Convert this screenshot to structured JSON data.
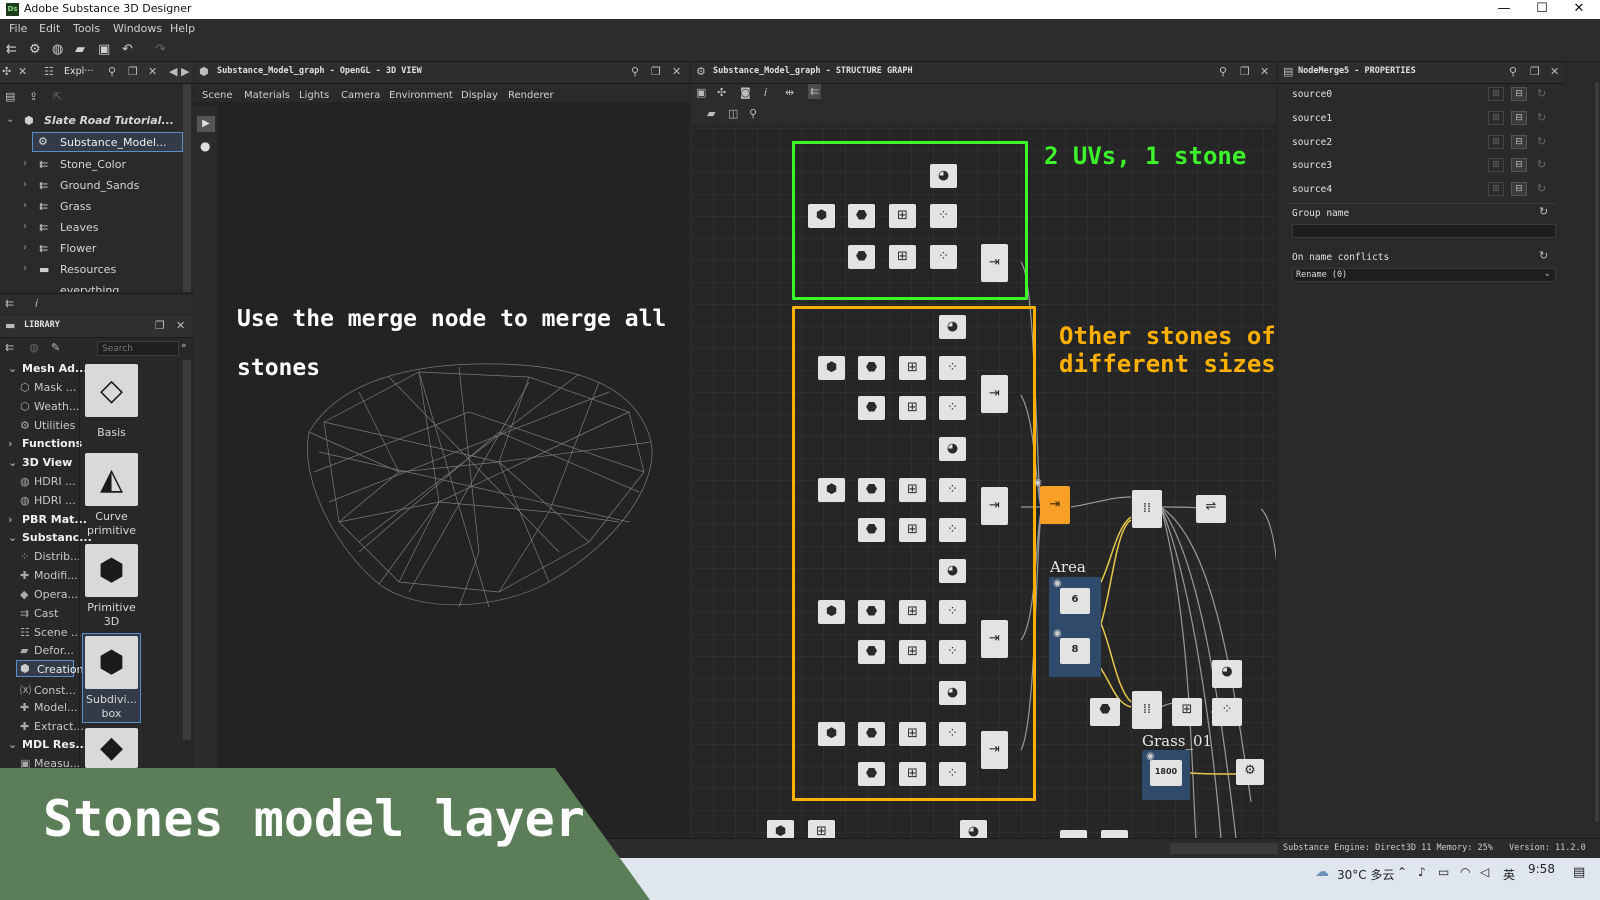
{
  "window": {
    "title": "Adobe Substance 3D Designer",
    "logo": "Ds"
  },
  "menu": [
    "File",
    "Edit",
    "Tools",
    "Windows",
    "Help"
  ],
  "explorer": {
    "tab": "Expl···",
    "package": "Slate Road Tutorial...",
    "items": [
      "Substance_Model...",
      "Stone_Color",
      "Ground_Sands",
      "Grass",
      "Leaves",
      "Flower",
      "Resources",
      "everything"
    ]
  },
  "library": {
    "title": "LIBRARY",
    "search_placeholder": "Search",
    "categories": [
      "Mesh Ad...",
      "Mask ...",
      "Weath...",
      "Utilities",
      "Functions",
      "3D View",
      "HDRI ...",
      "HDRI ...",
      "PBR Mat...",
      "Substanc...",
      "Distrib...",
      "Modifi...",
      "Opera...",
      "Cast",
      "Scene ...",
      "Defor...",
      "Creation",
      "Const...",
      "Model...",
      "Extract...",
      "MDL Res...",
      "Measu..."
    ],
    "tiles": [
      "Basis",
      "Curve primitive",
      "Primitive 3D",
      "Subdivi... box"
    ]
  },
  "view3d": {
    "title": "Substance_Model_graph - OpenGL - 3D VIEW",
    "tabs": [
      "Scene",
      "Materials",
      "Lights",
      "Camera",
      "Environment",
      "Display",
      "Renderer"
    ],
    "annotation_line1": "Use the merge node to merge all",
    "annotation_line2": "stones"
  },
  "graph": {
    "title": "Substance_Model_graph - STRUCTURE GRAPH",
    "annotation_top": "2 UVs, 1 stone",
    "annotation_mid": "Other stones of different sizes",
    "frame_area": "Area",
    "frame_grass": "Grass_01",
    "value_6": "6",
    "value_8": "8",
    "value_1800": "1800",
    "colors": {
      "green_frame": "#3cf52a",
      "orange_frame": "#ffb000",
      "merge_node": "#f7a025"
    }
  },
  "properties": {
    "title": "NodeMerge5 - PROPERTIES",
    "sources": [
      "source0",
      "source1",
      "source2",
      "source3",
      "source4"
    ],
    "group_name_label": "Group name",
    "conflicts_label": "On name conflicts",
    "conflicts_value": "Rename (0)"
  },
  "status": {
    "engine": "Substance Engine: Direct3D 11 Memory: 25%",
    "version": "Version: 11.2.0"
  },
  "taskbar": {
    "weather": "30°C 多云",
    "ime": "英",
    "time": "9:58"
  },
  "banner": {
    "text": "Stones model layer"
  }
}
